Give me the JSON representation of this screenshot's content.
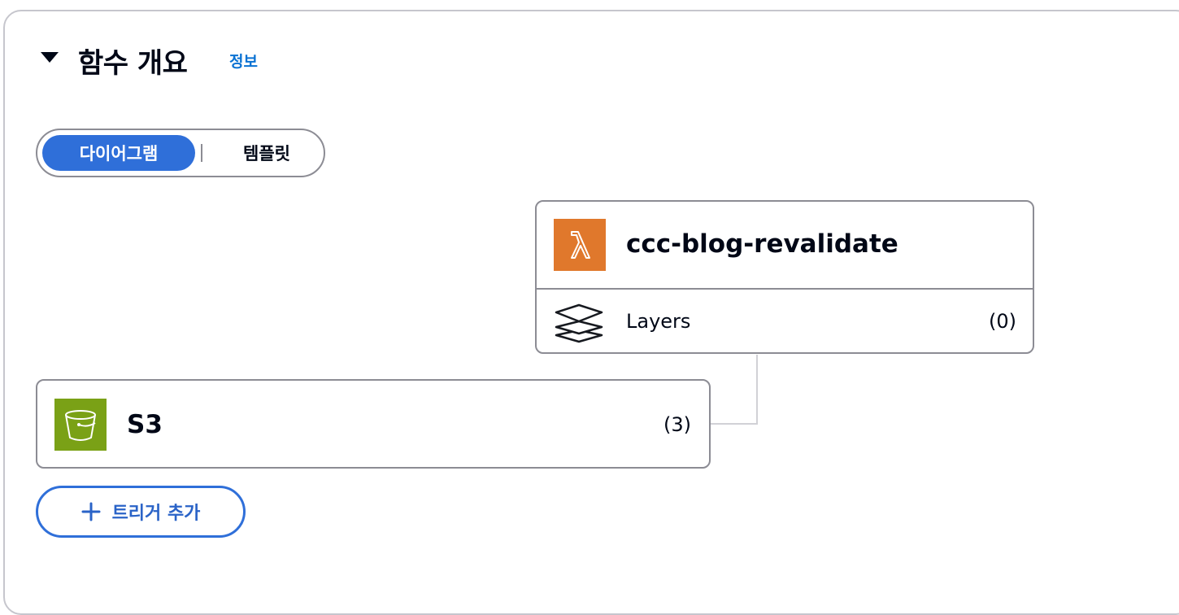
{
  "section": {
    "title": "함수 개요",
    "info_link": "정보"
  },
  "view_toggle": {
    "options": [
      "다이어그램",
      "템플릿"
    ],
    "selected": "다이어그램"
  },
  "function_card": {
    "name": "ccc-blog-revalidate",
    "icon": "lambda-icon",
    "layers_label": "Layers",
    "layers_count": "(0)"
  },
  "trigger_card": {
    "name": "S3",
    "icon": "s3-bucket-icon",
    "count": "(3)"
  },
  "add_trigger_button": {
    "label": "트리거 추가",
    "icon": "plus-icon"
  },
  "colors": {
    "accent": "#2f6fd9",
    "link": "#0972d3",
    "lambda_orange": "#e0782c",
    "s3_green": "#7aa116",
    "border": "#8c8c94"
  }
}
